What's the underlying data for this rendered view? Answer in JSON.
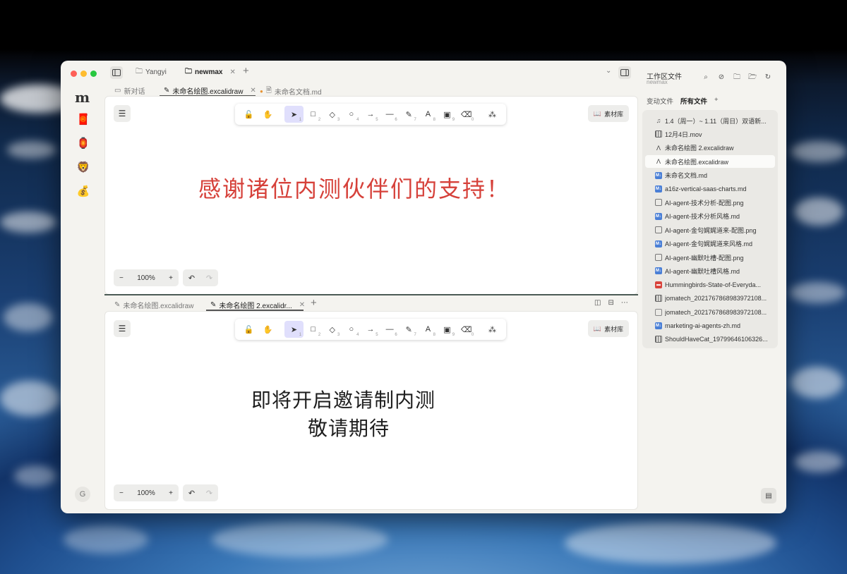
{
  "app": {
    "logo_text": "m",
    "avatar_initial": "G"
  },
  "window_tabs": [
    {
      "label": "Yangyi",
      "icon": "folder-icon"
    },
    {
      "label": "newmax",
      "icon": "folder-icon",
      "active": true
    }
  ],
  "top_pane": {
    "tabs": [
      {
        "label": "新对话",
        "icon": "chat-bubble-icon"
      },
      {
        "label": "未命名绘图.excalidraw",
        "icon": "pencil-icon",
        "active": true
      },
      {
        "label": "未命名文档.md",
        "icon": "document-icon",
        "modified": true
      }
    ],
    "canvas_text": "感谢诸位内测伙伴们的支持！",
    "canvas_text_color": "#d6413a",
    "zoom": "100%",
    "library_label": "素材库"
  },
  "bottom_pane": {
    "tabs": [
      {
        "label": "未命名绘图.excalidraw",
        "icon": "pencil-icon"
      },
      {
        "label": "未命名绘图 2.excalidr...",
        "icon": "pencil-icon",
        "active": true
      }
    ],
    "canvas_text_line1": "即将开启邀请制内测",
    "canvas_text_line2": "敬请期待",
    "zoom": "100%",
    "library_label": "素材库"
  },
  "toolbar_tools": [
    {
      "name": "lock-icon",
      "glyph": "🔓",
      "key": ""
    },
    {
      "name": "hand-icon",
      "glyph": "✋",
      "key": ""
    },
    {
      "name": "pointer-icon",
      "glyph": "➤",
      "key": "1",
      "selected": true
    },
    {
      "name": "rectangle-icon",
      "glyph": "□",
      "key": "2"
    },
    {
      "name": "diamond-icon",
      "glyph": "◇",
      "key": "3"
    },
    {
      "name": "circle-icon",
      "glyph": "○",
      "key": "4"
    },
    {
      "name": "arrow-icon",
      "glyph": "→",
      "key": "5"
    },
    {
      "name": "line-icon",
      "glyph": "—",
      "key": "6"
    },
    {
      "name": "pencil-draw-icon",
      "glyph": "✎",
      "key": "7"
    },
    {
      "name": "text-icon",
      "glyph": "A",
      "key": "8"
    },
    {
      "name": "image-icon",
      "glyph": "▣",
      "key": "9"
    },
    {
      "name": "eraser-icon",
      "glyph": "⌫",
      "key": "0"
    },
    {
      "name": "shapes-icon",
      "glyph": "⁂",
      "key": ""
    }
  ],
  "right_panel": {
    "title": "工作区文件",
    "subtitle": "newmax",
    "tab_changed": "变动文件",
    "tab_all": "所有文件",
    "files": [
      {
        "name": "1.4（周一）~ 1.11（周日）双语新...",
        "type": "audio"
      },
      {
        "name": "12月4日.mov",
        "type": "film"
      },
      {
        "name": "未命名绘图 2.excalidraw",
        "type": "exc"
      },
      {
        "name": "未命名绘图.excalidraw",
        "type": "exc",
        "selected": true
      },
      {
        "name": "未命名文档.md",
        "type": "md"
      },
      {
        "name": "a16z-vertical-saas-charts.md",
        "type": "md"
      },
      {
        "name": "AI-agent-技术分析-配图.png",
        "type": "img"
      },
      {
        "name": "AI-agent-技术分析风格.md",
        "type": "md"
      },
      {
        "name": "AI-agent-金句娓娓道来-配图.png",
        "type": "img"
      },
      {
        "name": "AI-agent-金句娓娓道来风格.md",
        "type": "md"
      },
      {
        "name": "AI-agent-幽默吐槽-配图.png",
        "type": "img"
      },
      {
        "name": "AI-agent-幽默吐槽风格.md",
        "type": "md"
      },
      {
        "name": "Hummingbirds-State-of-Everyda...",
        "type": "pdf"
      },
      {
        "name": "jomatech_2021767868983972108...",
        "type": "film"
      },
      {
        "name": "jomatech_2021767868983972108...",
        "type": "doc"
      },
      {
        "name": "marketing-ai-agents-zh.md",
        "type": "md"
      },
      {
        "name": "ShouldHaveCat_19799646106326...",
        "type": "film"
      }
    ]
  }
}
